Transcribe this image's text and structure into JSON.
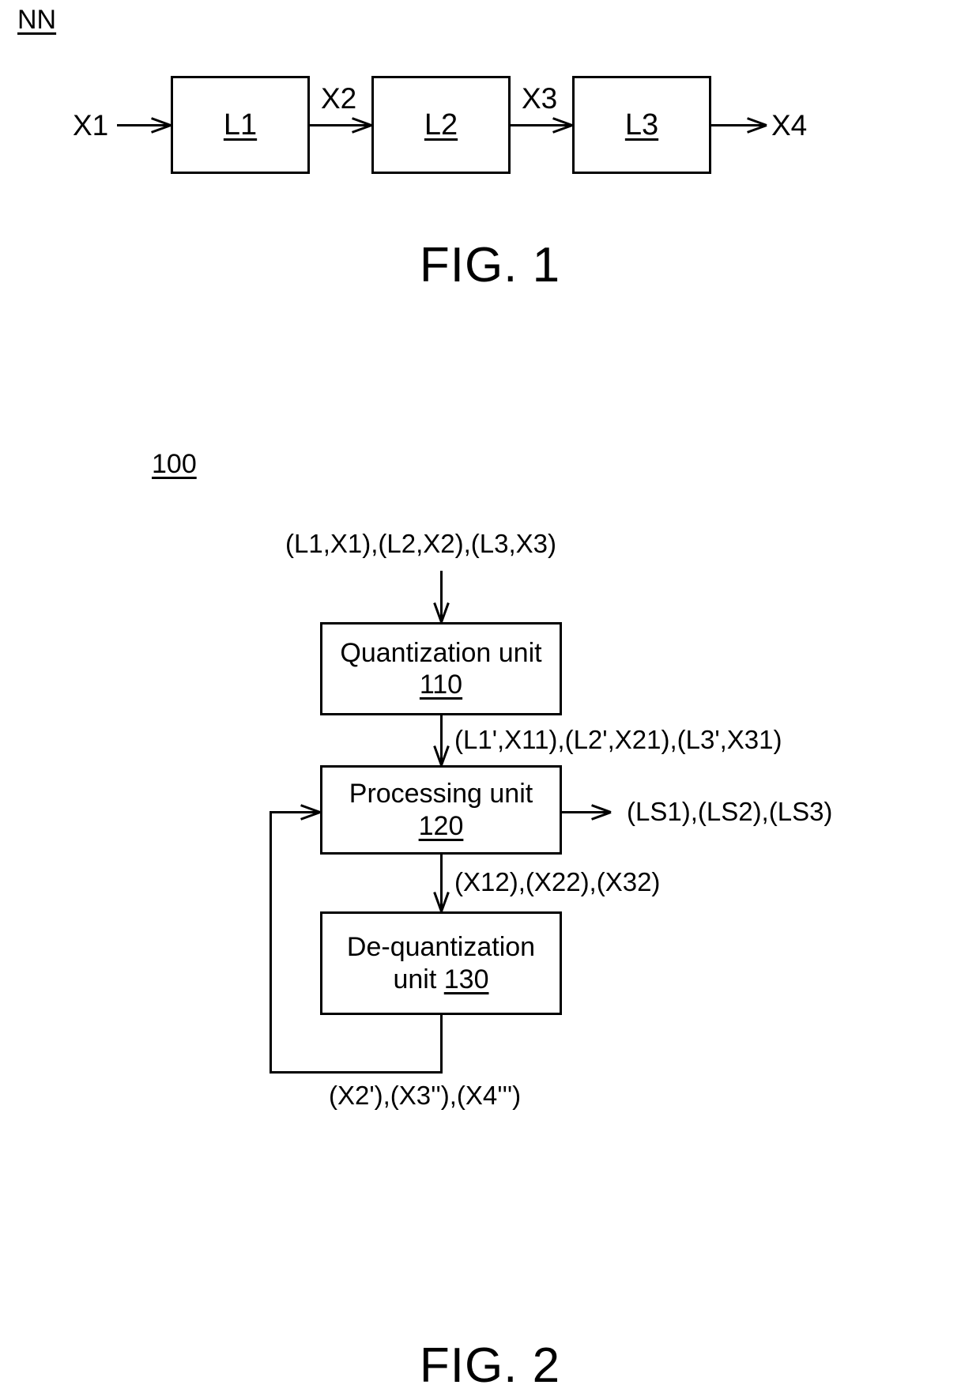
{
  "figures": [
    {
      "id": "fig1",
      "caption": "FIG. 1",
      "reference": "NN",
      "blocks": [
        {
          "label": "L1"
        },
        {
          "label": "L2"
        },
        {
          "label": "L3"
        }
      ],
      "signals": [
        {
          "label": "X1"
        },
        {
          "label": "X2"
        },
        {
          "label": "X3"
        },
        {
          "label": "X4"
        }
      ]
    },
    {
      "id": "fig2",
      "caption": "FIG. 2",
      "reference": "100",
      "blocks": [
        {
          "title": "Quantization unit",
          "number": "110"
        },
        {
          "title": "Processing unit",
          "number": "120"
        },
        {
          "title": "De-quantization",
          "title_line2": "unit",
          "number": "130"
        }
      ],
      "flows": {
        "input": "(L1,X1),(L2,X2),(L3,X3)",
        "quantized": "(L1',X11),(L2',X21),(L3',X31)",
        "side_output": "(LS1),(LS2),(LS3)",
        "processed": "(X12),(X22),(X32)",
        "feedback": "(X2'),(X3''),(X4''')"
      }
    }
  ]
}
